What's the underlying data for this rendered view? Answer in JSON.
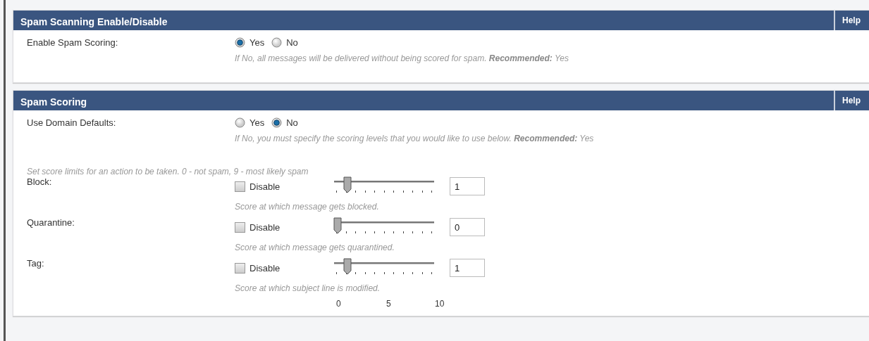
{
  "sections": [
    {
      "title": "Spam Scanning Enable/Disable",
      "help": "Help",
      "fields": [
        {
          "kind": "radio",
          "label": "Enable Spam Scoring:",
          "options": [
            {
              "label": "Yes",
              "selected": true
            },
            {
              "label": "No",
              "selected": false
            }
          ],
          "hint": "If No, all messages will be delivered without being scored for spam. **Recommended:** Yes"
        }
      ]
    },
    {
      "title": "Spam Scoring",
      "help": "Help",
      "fields": [
        {
          "kind": "radio",
          "label": "Use Domain Defaults:",
          "options": [
            {
              "label": "Yes",
              "selected": false
            },
            {
              "label": "No",
              "selected": true
            }
          ],
          "hint": "If No, you must specify the scoring levels that you would like to use below. **Recommended:** Yes"
        },
        {
          "kind": "note",
          "text": "Set score limits for an action to be taken. 0 - not spam, 9 - most likely spam"
        },
        {
          "kind": "slider",
          "label": "Block:",
          "disable": {
            "label": "Disable",
            "checked": false
          },
          "level": 0.1,
          "value": "1",
          "hint": "Score at which message gets blocked."
        },
        {
          "kind": "slider",
          "label": "Quarantine:",
          "disable": {
            "label": "Disable",
            "checked": false
          },
          "level": 0,
          "value": "0",
          "hint": "Score at which message gets quarantined."
        },
        {
          "kind": "slider",
          "label": "Tag:",
          "disable": {
            "label": "Disable",
            "checked": false
          },
          "level": 0.1,
          "value": "1",
          "hint": "Score at which subject line is modified."
        },
        {
          "kind": "scale",
          "labels": [
            "0",
            "5",
            "10"
          ]
        }
      ]
    }
  ]
}
